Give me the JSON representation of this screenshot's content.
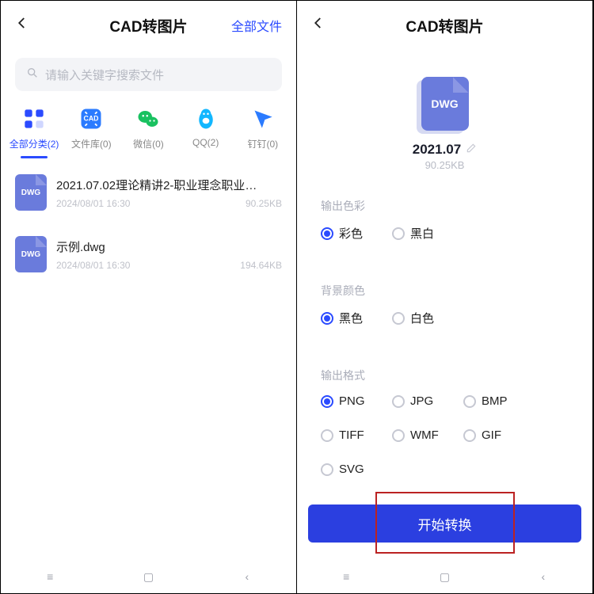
{
  "left": {
    "title": "CAD转图片",
    "headerRight": "全部文件",
    "searchPlaceholder": "请输入关键字搜索文件",
    "categories": [
      {
        "label": "全部分类(2)",
        "active": true,
        "iconBg": "#fff",
        "icon": "grid",
        "fg": "#2b4bff"
      },
      {
        "label": "文件库(0)",
        "active": false,
        "iconBg": "#2b7bff",
        "icon": "cad",
        "fg": "#fff"
      },
      {
        "label": "微信(0)",
        "active": false,
        "iconBg": "#fff",
        "icon": "wechat",
        "fg": "#19c160"
      },
      {
        "label": "QQ(2)",
        "active": false,
        "iconBg": "#fff",
        "icon": "qq",
        "fg": "#12b7ff"
      },
      {
        "label": "钉钉(0)",
        "active": false,
        "iconBg": "#fff",
        "icon": "ding",
        "fg": "#2b7bff"
      }
    ],
    "files": [
      {
        "name": "2021.07.02理论精讲2-职业理念职业…",
        "date": "2024/08/01  16:30",
        "size": "90.25KB",
        "ext": "DWG"
      },
      {
        "name": "示例.dwg",
        "date": "2024/08/01  16:30",
        "size": "194.64KB",
        "ext": "DWG"
      }
    ]
  },
  "right": {
    "title": "CAD转图片",
    "ext": "DWG",
    "filename": "2021.07",
    "filesize": "90.25KB",
    "sections": {
      "color": {
        "title": "输出色彩",
        "opts": [
          {
            "l": "彩色",
            "sel": true
          },
          {
            "l": "黑白",
            "sel": false
          }
        ]
      },
      "bg": {
        "title": "背景颜色",
        "opts": [
          {
            "l": "黑色",
            "sel": true
          },
          {
            "l": "白色",
            "sel": false
          }
        ]
      },
      "fmt": {
        "title": "输出格式",
        "opts": [
          {
            "l": "PNG",
            "sel": true
          },
          {
            "l": "JPG"
          },
          {
            "l": "BMP"
          },
          {
            "l": "TIFF"
          },
          {
            "l": "WMF"
          },
          {
            "l": "GIF"
          },
          {
            "l": "SVG"
          }
        ]
      }
    },
    "primary": "开始转换"
  }
}
